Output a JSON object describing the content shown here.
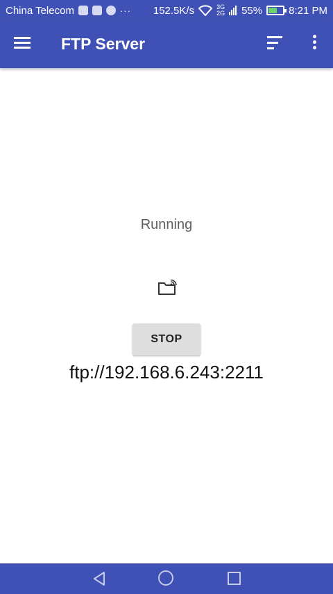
{
  "status_bar": {
    "carrier": "China Telecom",
    "overflow": "···",
    "net_speed": "152.5K/s",
    "network_top": "3G",
    "network_bottom": "2G",
    "battery": "55%",
    "time": "8:21 PM"
  },
  "app_bar": {
    "title": "FTP Server",
    "menu_icon": "hamburger-menu-icon",
    "sort_icon": "sort-icon",
    "more_icon": "more-vert-icon"
  },
  "main": {
    "status_text": "Running",
    "folder_icon": "folder-share-icon",
    "stop_label": "STOP",
    "address": "ftp://192.168.6.243:2211"
  },
  "nav_bar": {
    "back_icon": "back-icon",
    "home_icon": "home-icon",
    "recents_icon": "recents-icon"
  },
  "colors": {
    "primary": "#3f51b5",
    "button_bg": "#dedede"
  }
}
